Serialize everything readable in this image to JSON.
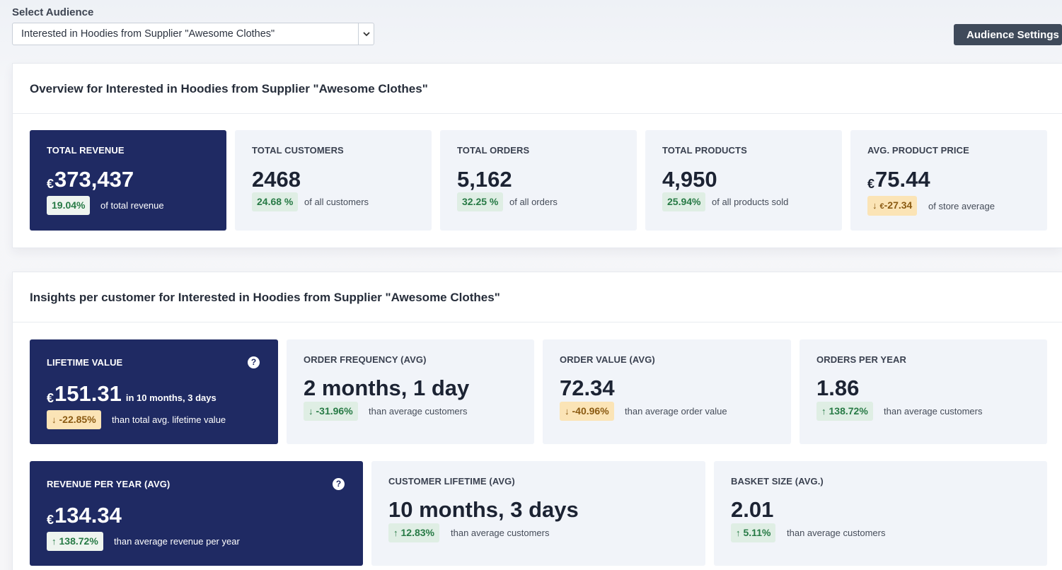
{
  "audience": {
    "label": "Select Audience",
    "selected": "Interested in Hoodies from Supplier \"Awesome Clothes\"",
    "settings_button": "Audience Settings"
  },
  "overview": {
    "title": "Overview for Interested in Hoodies from Supplier \"Awesome Clothes\"",
    "cards": {
      "revenue": {
        "label": "TOTAL REVENUE",
        "currency": "€",
        "value": "373,437",
        "badge": "19.04%",
        "note": "of total revenue"
      },
      "customers": {
        "label": "TOTAL CUSTOMERS",
        "value": "2468",
        "badge": "24.68 %",
        "note": "of all customers"
      },
      "orders": {
        "label": "TOTAL ORDERS",
        "value": "5,162",
        "badge": "32.25 %",
        "note": "of all orders"
      },
      "products": {
        "label": "TOTAL PRODUCTS",
        "value": "4,950",
        "badge": "25.94%",
        "note": "of all products sold"
      },
      "price": {
        "label": "AVG. PRODUCT PRICE",
        "currency": "€",
        "value": "75.44",
        "badge_currency": "€",
        "badge": "-27.34",
        "note": "of store average"
      }
    }
  },
  "insights": {
    "title": "Insights per customer for Interested in Hoodies from Supplier \"Awesome Clothes\"",
    "cards": {
      "ltv": {
        "label": "LIFETIME VALUE",
        "currency": "€",
        "value": "151.31",
        "suffix": "in 10 months, 3 days",
        "badge": "-22.85%",
        "note": "than total avg. lifetime value"
      },
      "frequency": {
        "label": "ORDER FREQUENCY (AVG)",
        "value": "2 months, 1 day",
        "badge": "-31.96%",
        "note": "than average customers"
      },
      "order_value": {
        "label": "ORDER VALUE (AVG)",
        "value": "72.34",
        "badge": "-40.96%",
        "note": "than average order value"
      },
      "orders_year": {
        "label": "ORDERS PER YEAR",
        "value": "1.86",
        "badge": "138.72%",
        "note": "than average customers"
      },
      "revenue_year": {
        "label": "REVENUE PER YEAR (AVG)",
        "currency": "€",
        "value": "134.34",
        "badge": "138.72%",
        "note": "than average revenue per year"
      },
      "lifetime": {
        "label": "CUSTOMER LIFETIME (AVG)",
        "value": "10 months, 3 days",
        "badge": "12.83%",
        "note": "than average customers"
      },
      "basket": {
        "label": "BASKET SIZE (AVG.)",
        "value": "2.01",
        "badge": "5.11%",
        "note": "than average customers"
      }
    }
  },
  "icons": {
    "help": "question-circle-icon",
    "up": "arrow-up-icon",
    "down": "arrow-down-icon",
    "chevron": "chevron-down-icon"
  },
  "colors": {
    "dark_card": "#1f2a63",
    "light_card": "#f1f4f9",
    "positive": "#277a45",
    "warning_bg": "#fbe4b6",
    "button": "#3f4a5a"
  }
}
